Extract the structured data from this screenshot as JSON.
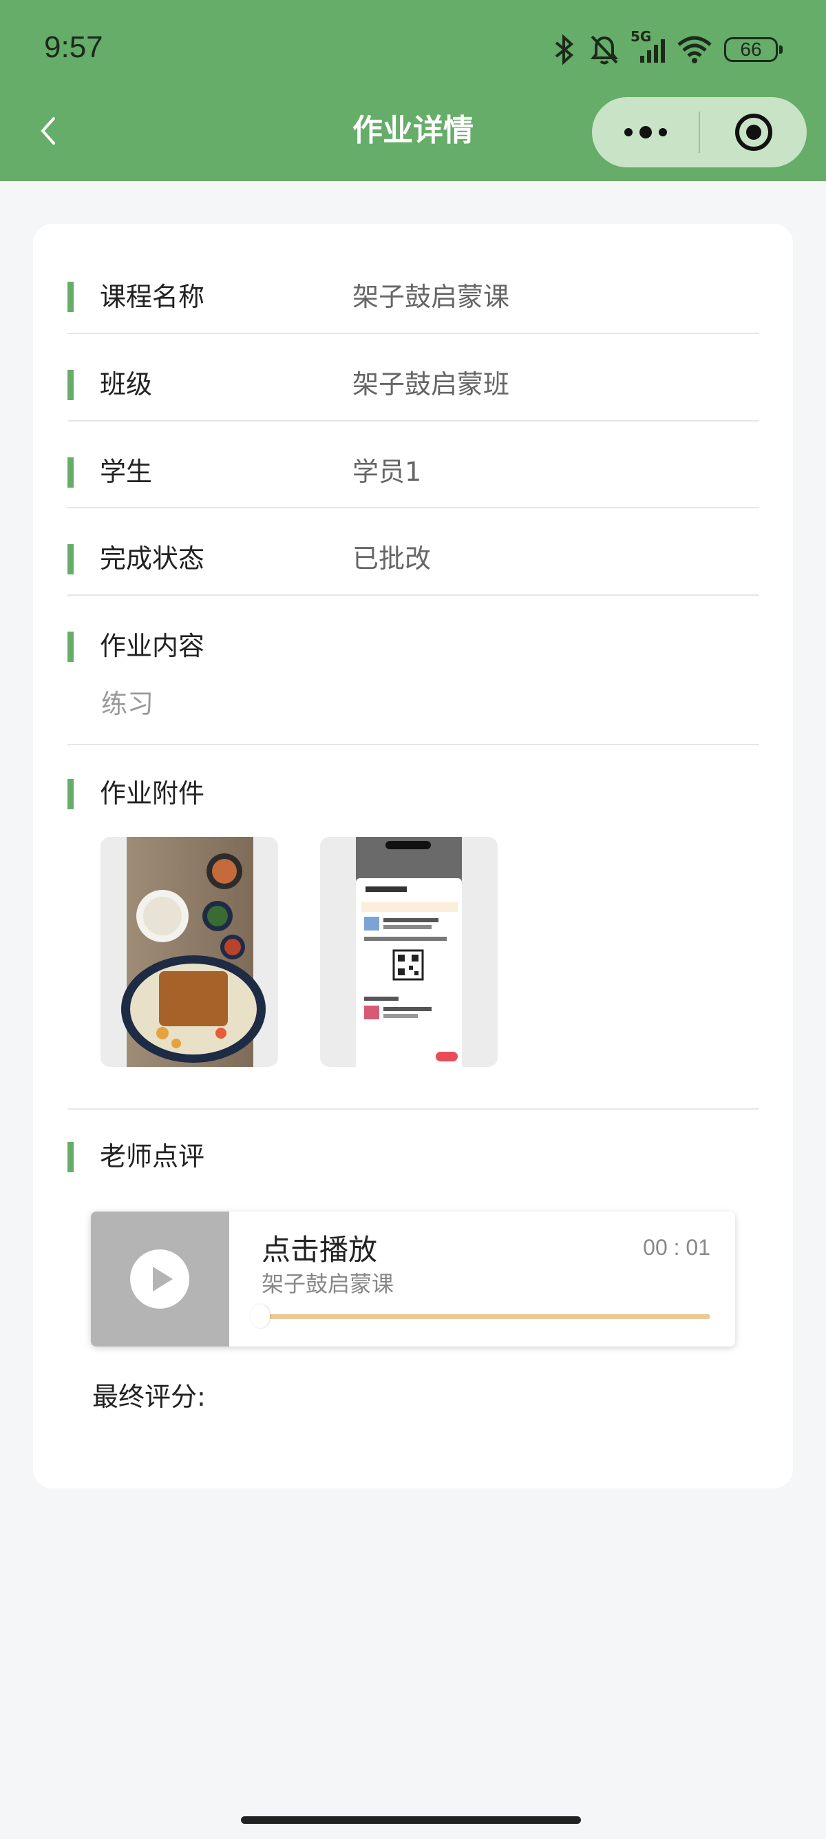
{
  "status_bar": {
    "time": "9:57",
    "network": "5G",
    "battery": "66",
    "icons": [
      "bluetooth-icon",
      "bell-off-icon",
      "signal-icon",
      "wifi-icon",
      "battery-icon"
    ]
  },
  "nav": {
    "title": "作业详情",
    "back_icon": "chevron-left-icon",
    "more_icon": "more-dots-icon",
    "close_icon": "target-icon",
    "color": "#66ad69"
  },
  "details": {
    "rows": [
      {
        "label": "课程名称",
        "value": "架子鼓启蒙课"
      },
      {
        "label": "班级",
        "value": "架子鼓启蒙班"
      },
      {
        "label": "学生",
        "value": "学员1"
      },
      {
        "label": "完成状态",
        "value": "已批改"
      }
    ],
    "content_label": "作业内容",
    "content_value": "练习",
    "attachments_label": "作业附件",
    "attachments": [
      "food-photo",
      "phone-screenshot"
    ],
    "review_label": "老师点评"
  },
  "audio": {
    "title": "点击播放",
    "subtitle": "架子鼓启蒙课",
    "time": "00 : 01",
    "progress": 0.0
  },
  "final_score_label": "最终评分:"
}
